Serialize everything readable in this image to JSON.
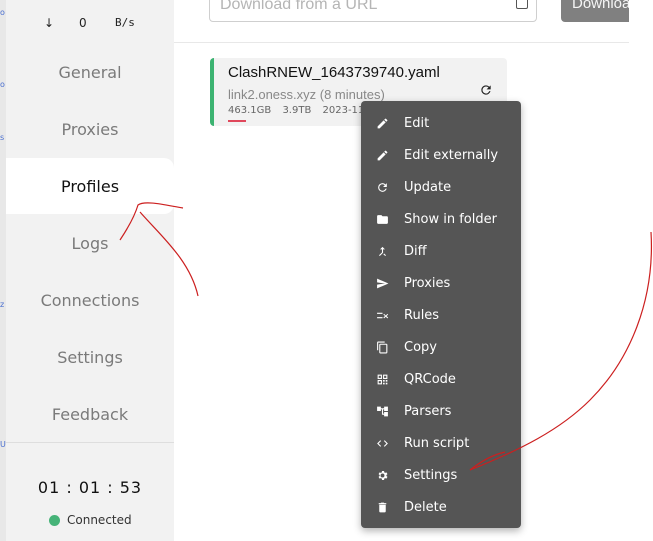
{
  "traffic": {
    "arrow": "↓",
    "value": "0",
    "unit": "B/s"
  },
  "nav": {
    "items": [
      {
        "label": "General"
      },
      {
        "label": "Proxies"
      },
      {
        "label": "Profiles"
      },
      {
        "label": "Logs"
      },
      {
        "label": "Connections"
      },
      {
        "label": "Settings"
      },
      {
        "label": "Feedback"
      }
    ]
  },
  "clock": "01 : 01 : 53",
  "status": "Connected",
  "url_input": {
    "placeholder": "Download from a URL"
  },
  "download_button": "Downloa",
  "profile": {
    "name": "ClashRNEW_1643739740.yaml",
    "source": "link2.oness.xyz (8 minutes)",
    "used": "463.1GB",
    "total": "3.9TB",
    "date": "2023-11",
    "usage_fraction": 0.12
  },
  "menu": {
    "items": [
      {
        "label": "Edit",
        "icon": "pencil-icon"
      },
      {
        "label": "Edit externally",
        "icon": "pencil-icon"
      },
      {
        "label": "Update",
        "icon": "refresh-icon"
      },
      {
        "label": "Show in folder",
        "icon": "folder-icon"
      },
      {
        "label": "Diff",
        "icon": "merge-icon"
      },
      {
        "label": "Proxies",
        "icon": "send-icon"
      },
      {
        "label": "Rules",
        "icon": "rules-icon"
      },
      {
        "label": "Copy",
        "icon": "copy-icon"
      },
      {
        "label": "QRCode",
        "icon": "qrcode-icon"
      },
      {
        "label": "Parsers",
        "icon": "tree-icon"
      },
      {
        "label": "Run script",
        "icon": "code-icon"
      },
      {
        "label": "Settings",
        "icon": "gear-icon"
      },
      {
        "label": "Delete",
        "icon": "trash-icon"
      }
    ]
  },
  "colors": {
    "accent": "#3cb371",
    "status": "#46b378",
    "menu_bg": "#555555",
    "usage_bar": "#e0485c",
    "annotation": "#cc1f1f"
  }
}
